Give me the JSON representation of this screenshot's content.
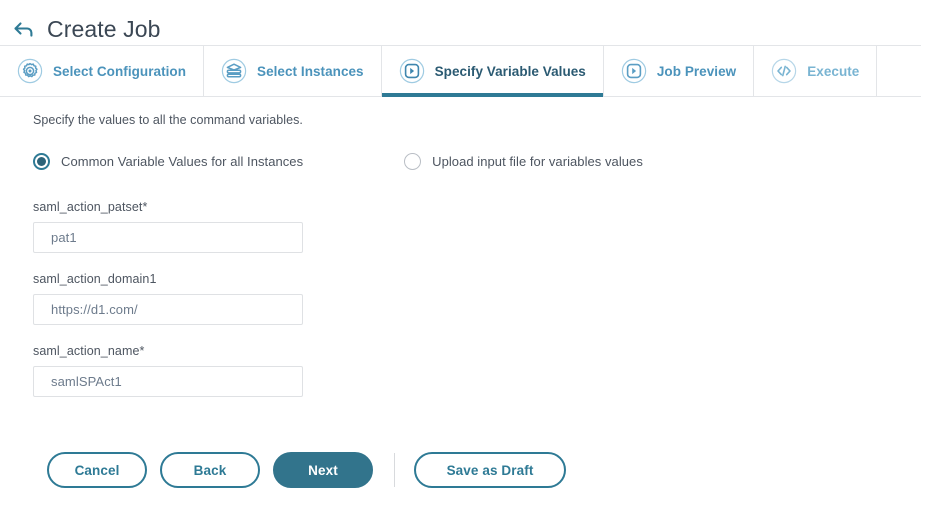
{
  "header": {
    "back_icon": "back-arrow-icon",
    "title": "Create Job"
  },
  "tabs": [
    {
      "label": "Select Configuration",
      "icon": "gear-icon",
      "state": "done"
    },
    {
      "label": "Select Instances",
      "icon": "server-stack-icon",
      "state": "done"
    },
    {
      "label": "Specify Variable Values",
      "icon": "play-circle-icon",
      "state": "active"
    },
    {
      "label": "Job Preview",
      "icon": "play-circle-icon",
      "state": "done"
    },
    {
      "label": "Execute",
      "icon": "code-brackets-icon",
      "state": "upcoming"
    }
  ],
  "main": {
    "hint": "Specify the values to all the command variables.",
    "radio_options": [
      {
        "label": "Common Variable Values for all Instances",
        "selected": true
      },
      {
        "label": "Upload input file for variables values",
        "selected": false
      }
    ],
    "fields": [
      {
        "label": "saml_action_patset*",
        "value": "pat1",
        "placeholder": ""
      },
      {
        "label": "saml_action_domain1",
        "value": "https://d1.com/",
        "placeholder": ""
      },
      {
        "label": "saml_action_name*",
        "value": "samlSPAct1",
        "placeholder": ""
      }
    ]
  },
  "footer": {
    "cancel_label": "Cancel",
    "back_label": "Back",
    "next_label": "Next",
    "draft_label": "Save as Draft"
  },
  "colors": {
    "accent": "#2e7a95",
    "primary_button": "#32748c",
    "tab_inactive": "#5b9ec4",
    "tab_active_text": "#2b5a72",
    "text": "#4d5560"
  }
}
